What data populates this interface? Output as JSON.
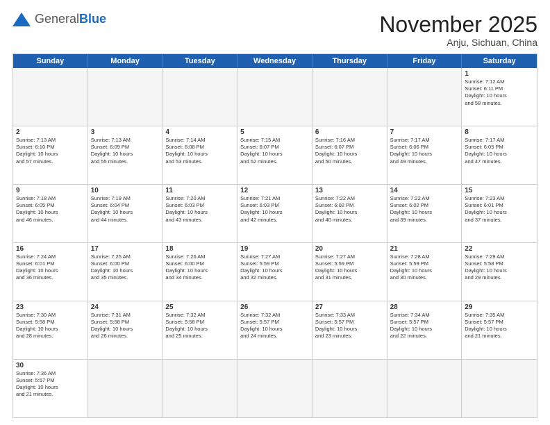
{
  "header": {
    "logo_general": "General",
    "logo_blue": "Blue",
    "month_title": "November 2025",
    "location": "Anju, Sichuan, China"
  },
  "days_of_week": [
    "Sunday",
    "Monday",
    "Tuesday",
    "Wednesday",
    "Thursday",
    "Friday",
    "Saturday"
  ],
  "weeks": [
    [
      {
        "day": "",
        "empty": true,
        "text": ""
      },
      {
        "day": "",
        "empty": true,
        "text": ""
      },
      {
        "day": "",
        "empty": true,
        "text": ""
      },
      {
        "day": "",
        "empty": true,
        "text": ""
      },
      {
        "day": "",
        "empty": true,
        "text": ""
      },
      {
        "day": "",
        "empty": true,
        "text": ""
      },
      {
        "day": "1",
        "empty": false,
        "text": "Sunrise: 7:12 AM\nSunset: 6:11 PM\nDaylight: 10 hours\nand 58 minutes."
      }
    ],
    [
      {
        "day": "2",
        "empty": false,
        "text": "Sunrise: 7:13 AM\nSunset: 6:10 PM\nDaylight: 10 hours\nand 57 minutes."
      },
      {
        "day": "3",
        "empty": false,
        "text": "Sunrise: 7:13 AM\nSunset: 6:09 PM\nDaylight: 10 hours\nand 55 minutes."
      },
      {
        "day": "4",
        "empty": false,
        "text": "Sunrise: 7:14 AM\nSunset: 6:08 PM\nDaylight: 10 hours\nand 53 minutes."
      },
      {
        "day": "5",
        "empty": false,
        "text": "Sunrise: 7:15 AM\nSunset: 6:07 PM\nDaylight: 10 hours\nand 52 minutes."
      },
      {
        "day": "6",
        "empty": false,
        "text": "Sunrise: 7:16 AM\nSunset: 6:07 PM\nDaylight: 10 hours\nand 50 minutes."
      },
      {
        "day": "7",
        "empty": false,
        "text": "Sunrise: 7:17 AM\nSunset: 6:06 PM\nDaylight: 10 hours\nand 49 minutes."
      },
      {
        "day": "8",
        "empty": false,
        "text": "Sunrise: 7:17 AM\nSunset: 6:05 PM\nDaylight: 10 hours\nand 47 minutes."
      }
    ],
    [
      {
        "day": "9",
        "empty": false,
        "text": "Sunrise: 7:18 AM\nSunset: 6:05 PM\nDaylight: 10 hours\nand 46 minutes."
      },
      {
        "day": "10",
        "empty": false,
        "text": "Sunrise: 7:19 AM\nSunset: 6:04 PM\nDaylight: 10 hours\nand 44 minutes."
      },
      {
        "day": "11",
        "empty": false,
        "text": "Sunrise: 7:20 AM\nSunset: 6:03 PM\nDaylight: 10 hours\nand 43 minutes."
      },
      {
        "day": "12",
        "empty": false,
        "text": "Sunrise: 7:21 AM\nSunset: 6:03 PM\nDaylight: 10 hours\nand 42 minutes."
      },
      {
        "day": "13",
        "empty": false,
        "text": "Sunrise: 7:22 AM\nSunset: 6:02 PM\nDaylight: 10 hours\nand 40 minutes."
      },
      {
        "day": "14",
        "empty": false,
        "text": "Sunrise: 7:22 AM\nSunset: 6:02 PM\nDaylight: 10 hours\nand 39 minutes."
      },
      {
        "day": "15",
        "empty": false,
        "text": "Sunrise: 7:23 AM\nSunset: 6:01 PM\nDaylight: 10 hours\nand 37 minutes."
      }
    ],
    [
      {
        "day": "16",
        "empty": false,
        "text": "Sunrise: 7:24 AM\nSunset: 6:01 PM\nDaylight: 10 hours\nand 36 minutes."
      },
      {
        "day": "17",
        "empty": false,
        "text": "Sunrise: 7:25 AM\nSunset: 6:00 PM\nDaylight: 10 hours\nand 35 minutes."
      },
      {
        "day": "18",
        "empty": false,
        "text": "Sunrise: 7:26 AM\nSunset: 6:00 PM\nDaylight: 10 hours\nand 34 minutes."
      },
      {
        "day": "19",
        "empty": false,
        "text": "Sunrise: 7:27 AM\nSunset: 5:59 PM\nDaylight: 10 hours\nand 32 minutes."
      },
      {
        "day": "20",
        "empty": false,
        "text": "Sunrise: 7:27 AM\nSunset: 5:59 PM\nDaylight: 10 hours\nand 31 minutes."
      },
      {
        "day": "21",
        "empty": false,
        "text": "Sunrise: 7:28 AM\nSunset: 5:59 PM\nDaylight: 10 hours\nand 30 minutes."
      },
      {
        "day": "22",
        "empty": false,
        "text": "Sunrise: 7:29 AM\nSunset: 5:58 PM\nDaylight: 10 hours\nand 29 minutes."
      }
    ],
    [
      {
        "day": "23",
        "empty": false,
        "text": "Sunrise: 7:30 AM\nSunset: 5:58 PM\nDaylight: 10 hours\nand 28 minutes."
      },
      {
        "day": "24",
        "empty": false,
        "text": "Sunrise: 7:31 AM\nSunset: 5:58 PM\nDaylight: 10 hours\nand 26 minutes."
      },
      {
        "day": "25",
        "empty": false,
        "text": "Sunrise: 7:32 AM\nSunset: 5:58 PM\nDaylight: 10 hours\nand 25 minutes."
      },
      {
        "day": "26",
        "empty": false,
        "text": "Sunrise: 7:32 AM\nSunset: 5:57 PM\nDaylight: 10 hours\nand 24 minutes."
      },
      {
        "day": "27",
        "empty": false,
        "text": "Sunrise: 7:33 AM\nSunset: 5:57 PM\nDaylight: 10 hours\nand 23 minutes."
      },
      {
        "day": "28",
        "empty": false,
        "text": "Sunrise: 7:34 AM\nSunset: 5:57 PM\nDaylight: 10 hours\nand 22 minutes."
      },
      {
        "day": "29",
        "empty": false,
        "text": "Sunrise: 7:35 AM\nSunset: 5:57 PM\nDaylight: 10 hours\nand 21 minutes."
      }
    ],
    [
      {
        "day": "30",
        "empty": false,
        "text": "Sunrise: 7:36 AM\nSunset: 5:57 PM\nDaylight: 10 hours\nand 21 minutes."
      },
      {
        "day": "",
        "empty": true,
        "text": ""
      },
      {
        "day": "",
        "empty": true,
        "text": ""
      },
      {
        "day": "",
        "empty": true,
        "text": ""
      },
      {
        "day": "",
        "empty": true,
        "text": ""
      },
      {
        "day": "",
        "empty": true,
        "text": ""
      },
      {
        "day": "",
        "empty": true,
        "text": ""
      }
    ]
  ]
}
